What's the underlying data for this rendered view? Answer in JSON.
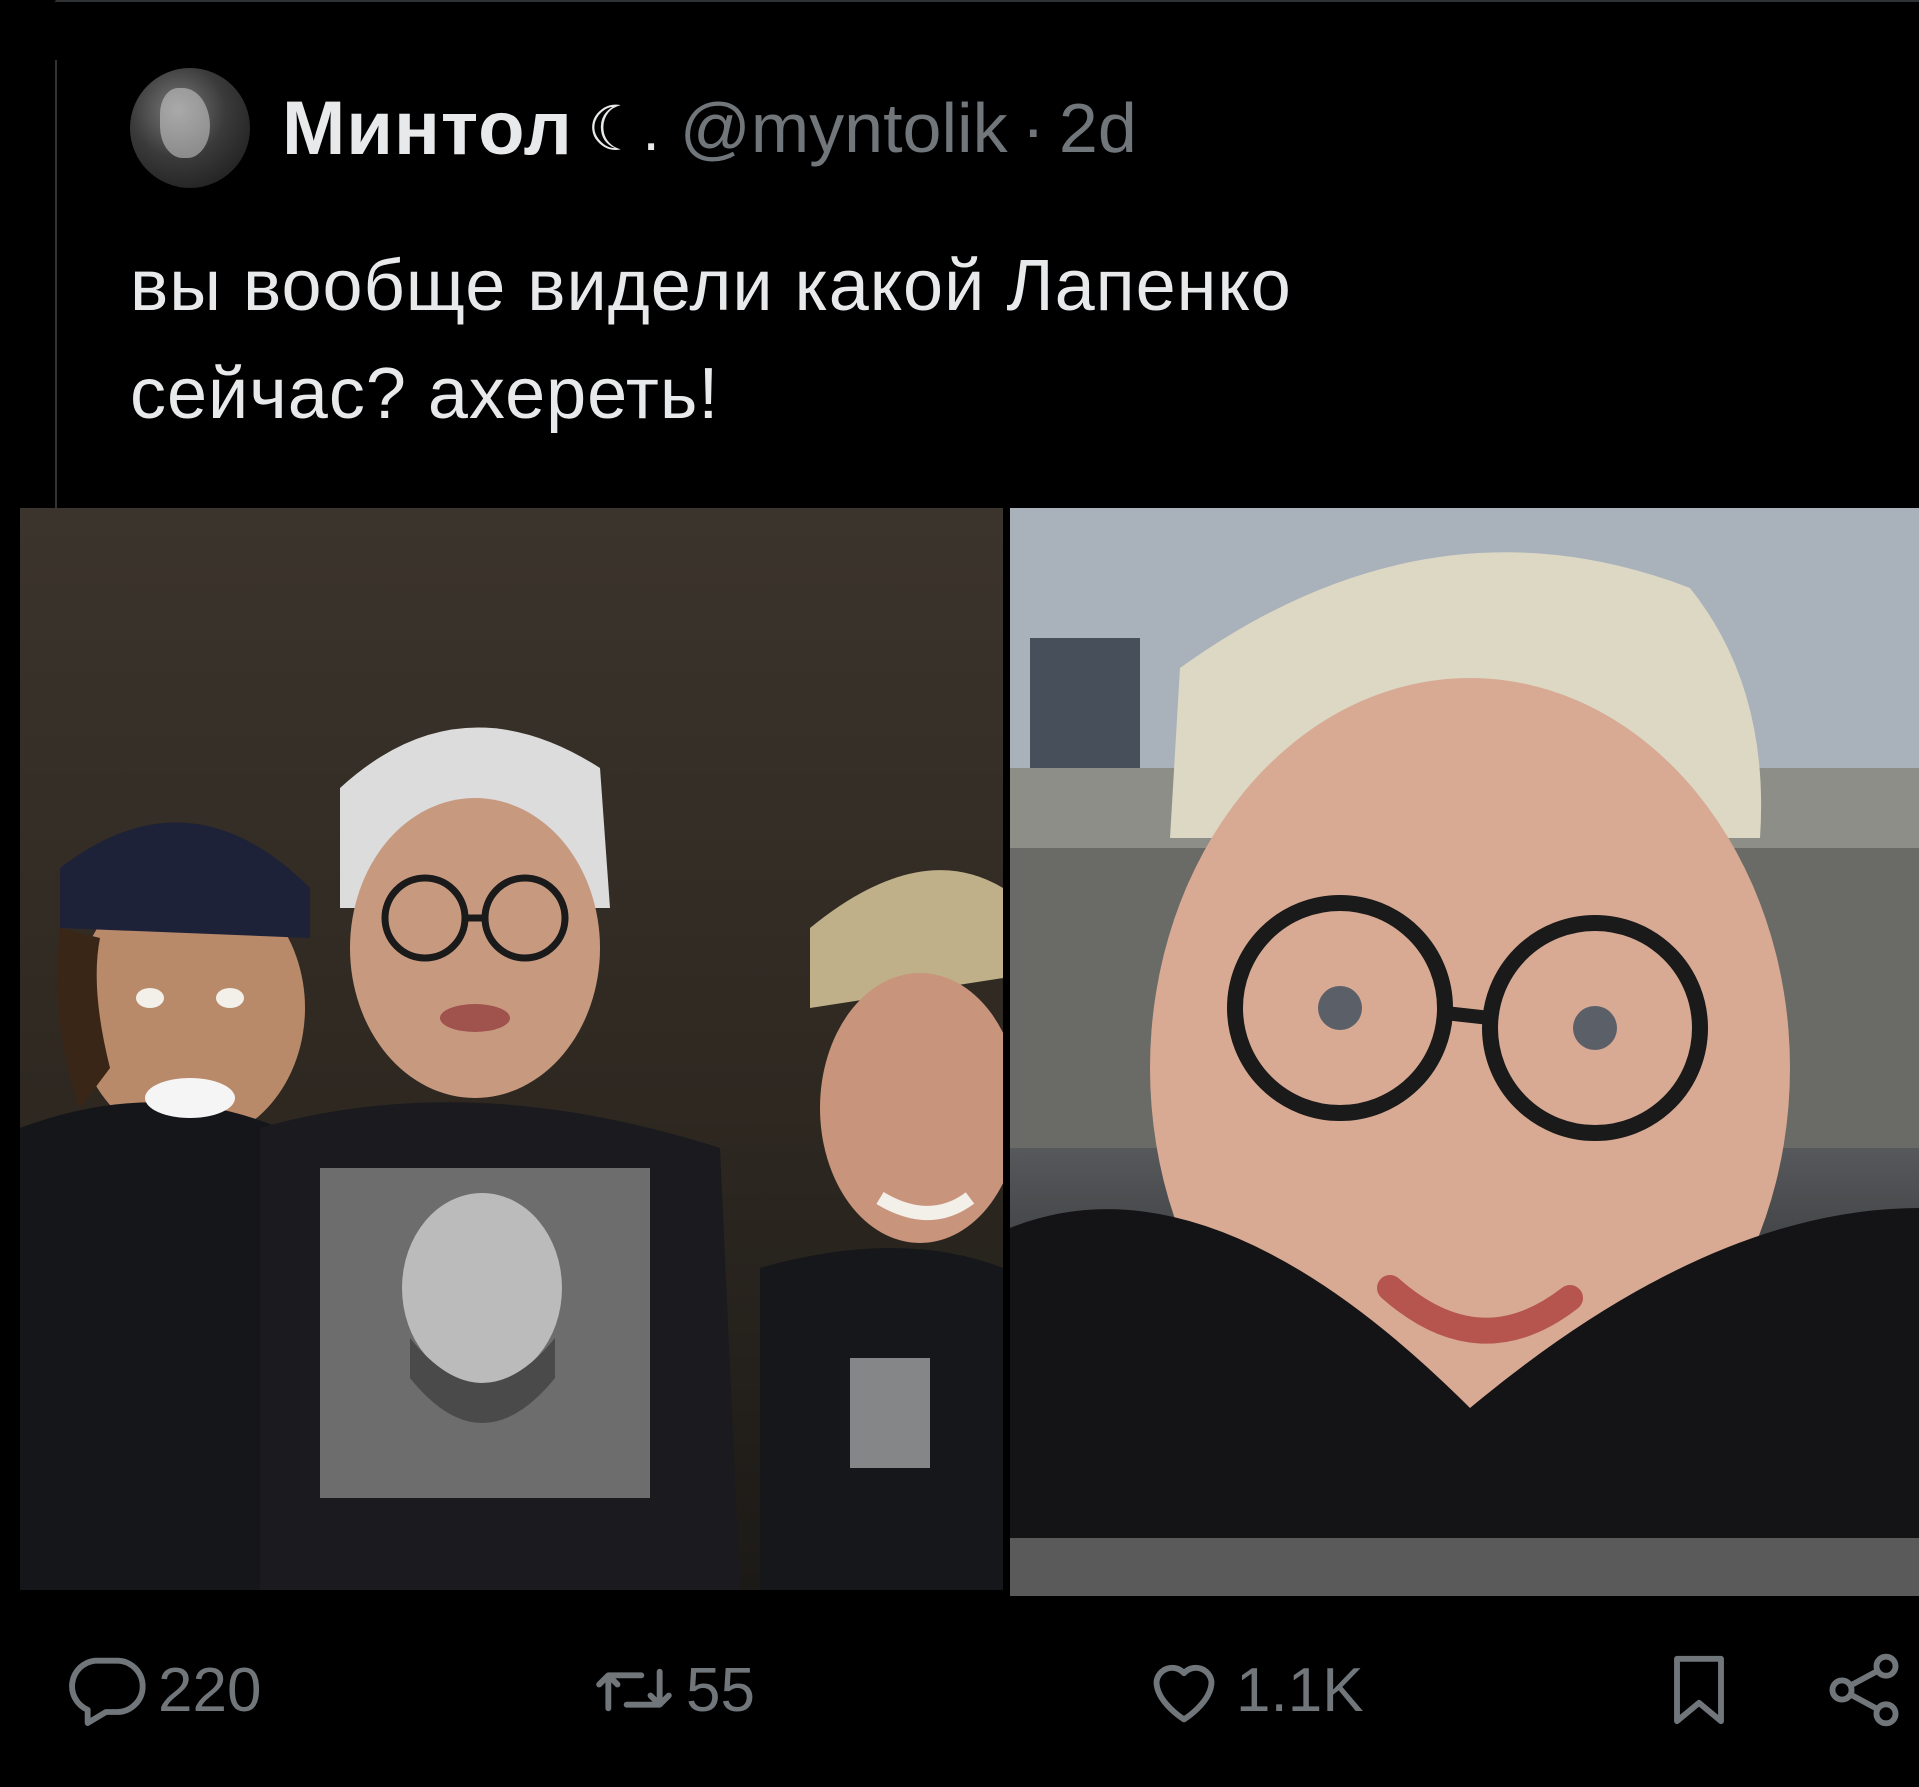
{
  "tweet": {
    "display_name": "Минтол",
    "name_decoration": "☾.",
    "handle": "@myntolik",
    "separator": "·",
    "time": "2d",
    "text_lines": [
      "вы вообще видели какой Лапенко",
      "сейчас? ахереть!"
    ]
  },
  "media": [
    {
      "kind": "photo",
      "icon": "group-photo"
    },
    {
      "kind": "photo",
      "icon": "selfie-photo"
    }
  ],
  "actions": {
    "reply_count": "220",
    "retweet_count": "55",
    "like_count": "1.1K"
  },
  "icons": {
    "reply": "comment-icon",
    "retweet": "retweet-icon",
    "like": "heart-icon",
    "bookmark": "bookmark-icon",
    "share": "share-icon"
  },
  "colors": {
    "background": "#000000",
    "text_primary": "#e7e9ea",
    "text_secondary": "#71767b",
    "border": "#2f3336"
  }
}
